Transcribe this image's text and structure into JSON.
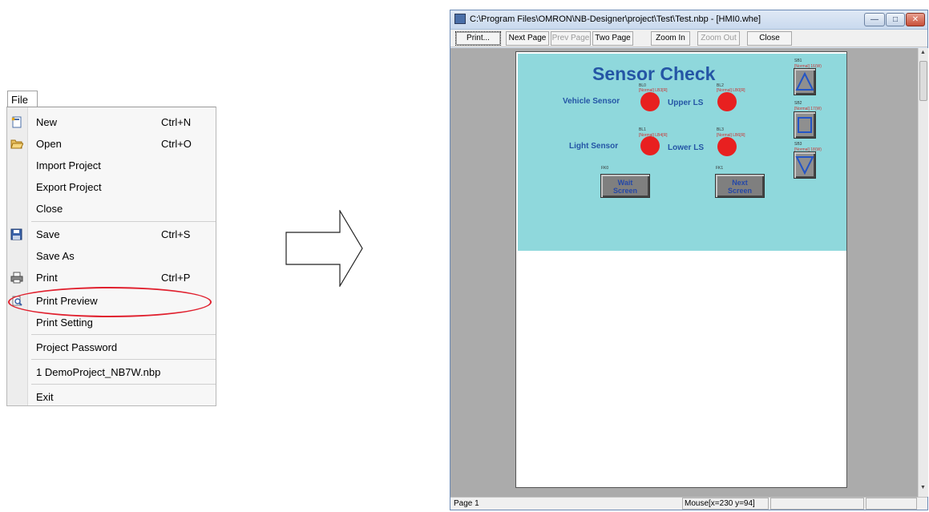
{
  "file_menu": {
    "tab_label": "File",
    "items": [
      {
        "label": "New",
        "shortcut": "Ctrl+N",
        "icon": "new-document-icon"
      },
      {
        "label": "Open",
        "shortcut": "Ctrl+O",
        "icon": "open-folder-icon"
      },
      {
        "label": "Import Project",
        "shortcut": ""
      },
      {
        "label": "Export Project",
        "shortcut": ""
      },
      {
        "label": "Close",
        "shortcut": ""
      },
      {
        "label": "Save",
        "shortcut": "Ctrl+S",
        "icon": "floppy-disk-icon"
      },
      {
        "label": "Save As",
        "shortcut": ""
      },
      {
        "label": "Print",
        "shortcut": "Ctrl+P",
        "icon": "printer-icon"
      },
      {
        "label": "Print Preview",
        "shortcut": "",
        "icon": "print-preview-icon"
      },
      {
        "label": "Print Setting",
        "shortcut": ""
      },
      {
        "label": "Project Password",
        "shortcut": ""
      },
      {
        "label": "1 DemoProject_NB7W.nbp",
        "shortcut": ""
      },
      {
        "label": "Exit",
        "shortcut": ""
      }
    ],
    "highlight_color": "#e0202e"
  },
  "preview_window": {
    "title": "C:\\Program Files\\OMRON\\NB-Designer\\project\\Test\\Test.nbp - [HMI0.whe]",
    "toolbar": {
      "print": "Print...",
      "next_page": "Next Page",
      "prev_page": "Prev Page",
      "two_page": "Two Page",
      "zoom_in": "Zoom In",
      "zoom_out": "Zoom Out",
      "close": "Close"
    },
    "status": {
      "page": "Page 1",
      "mouse": "Mouse[x=230  y=94]"
    }
  },
  "screen": {
    "title": "Sensor Check",
    "background": "#8fd8dc",
    "vehicle_sensor": "Vehicle Sensor",
    "upper_ls": "Upper LS",
    "light_sensor": "Light Sensor",
    "lower_ls": "Lower LS",
    "lamps": [
      {
        "id": "BL0",
        "addr": "LB3[R]"
      },
      {
        "id": "BL2",
        "addr": "LB0[R]"
      },
      {
        "id": "BL1",
        "addr": "LB4[R]"
      },
      {
        "id": "BL3",
        "addr": "LB6[R]"
      }
    ],
    "function_keys": [
      {
        "id": "FK0",
        "line1": "Wait",
        "line2": "Screen"
      },
      {
        "id": "FK1",
        "line1": "Next",
        "line2": "Screen"
      }
    ],
    "switches": [
      {
        "id": "SB1",
        "addr": "16(W)"
      },
      {
        "id": "SB2",
        "addr": "17(W)"
      },
      {
        "id": "SB3",
        "addr": "18(W)"
      }
    ]
  }
}
